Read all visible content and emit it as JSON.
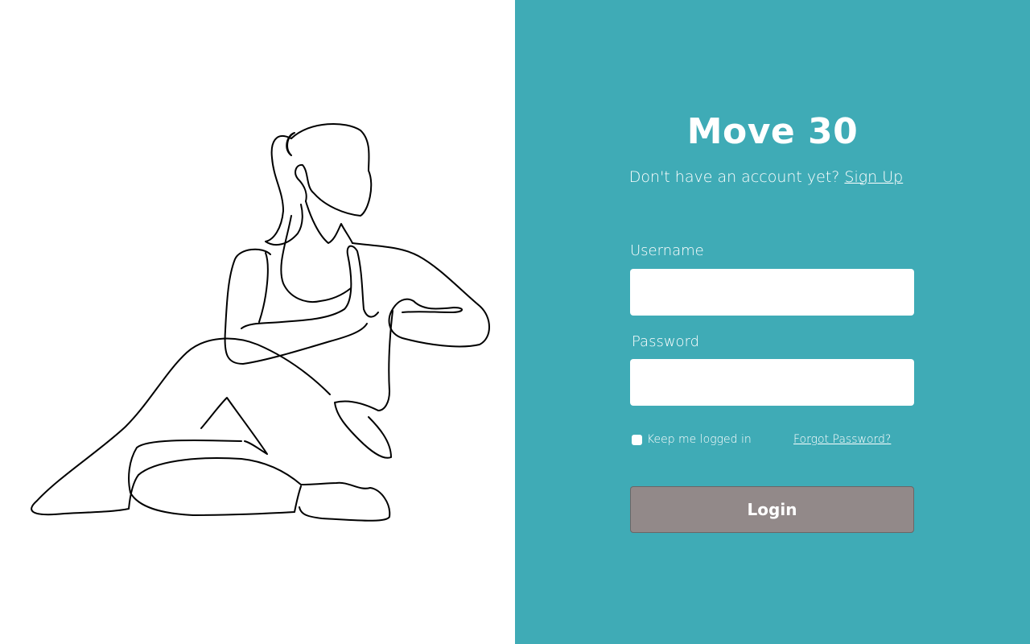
{
  "colors": {
    "panel_background": "#3fabb6",
    "button_background": "#928989",
    "text_on_panel": "#ffffff",
    "line_art": "#000000"
  },
  "illustration": {
    "icon": "yoga-woman-line-art"
  },
  "header": {
    "title": "Move 30",
    "no_account_text": "Don't have an account yet?",
    "signup_link": "Sign Up"
  },
  "form": {
    "username_label": "Username",
    "username_value": "",
    "password_label": "Password",
    "password_value": "",
    "keep_logged_in_label": "Keep me logged in",
    "keep_logged_in_checked": false,
    "forgot_password_link": "Forgot Password?",
    "login_button": "Login"
  }
}
